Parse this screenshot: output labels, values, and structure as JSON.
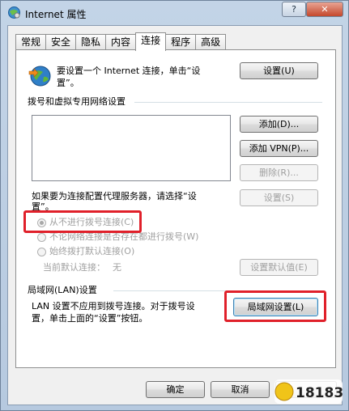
{
  "window": {
    "title": "Internet 属性",
    "help_label": "?",
    "close_label": "✕"
  },
  "tabs": [
    {
      "label": "常规"
    },
    {
      "label": "安全"
    },
    {
      "label": "隐私"
    },
    {
      "label": "内容"
    },
    {
      "label": "连接",
      "active": true
    },
    {
      "label": "程序"
    },
    {
      "label": "高级"
    }
  ],
  "setup": {
    "text_line1": "要设置一个 Internet 连接，单击“设",
    "text_line2": "置”。",
    "button": "设置(U)"
  },
  "dialup": {
    "heading": "拨号和虚拟专用网络设置",
    "add_button": "添加(D)...",
    "add_vpn_button": "添加 VPN(P)...",
    "remove_button": "删除(R)...",
    "settings_button": "设置(S)",
    "proxy_text_line1": "如果要为连接配置代理服务器，请选择“设",
    "proxy_text_line2": "置”。",
    "radio_never": "从不进行拨号连接(C)",
    "radio_when_no_network": "不论网络连接是否存在都进行拨号(W)",
    "radio_always": "始终拨打默认连接(O)",
    "current_default_label": "当前默认连接：",
    "current_default_value": "无",
    "set_default_button": "设置默认值(E)"
  },
  "lan": {
    "heading": "局域网(LAN)设置",
    "text_line1": "LAN 设置不应用到拨号连接。对于拨号设",
    "text_line2": "置，单击上面的“设置”按钮。",
    "button": "局域网设置(L)"
  },
  "footer": {
    "ok_button": "确定",
    "cancel_button": "取消"
  },
  "watermark": {
    "text": "18183"
  },
  "colors": {
    "highlight": "#e0202a"
  }
}
